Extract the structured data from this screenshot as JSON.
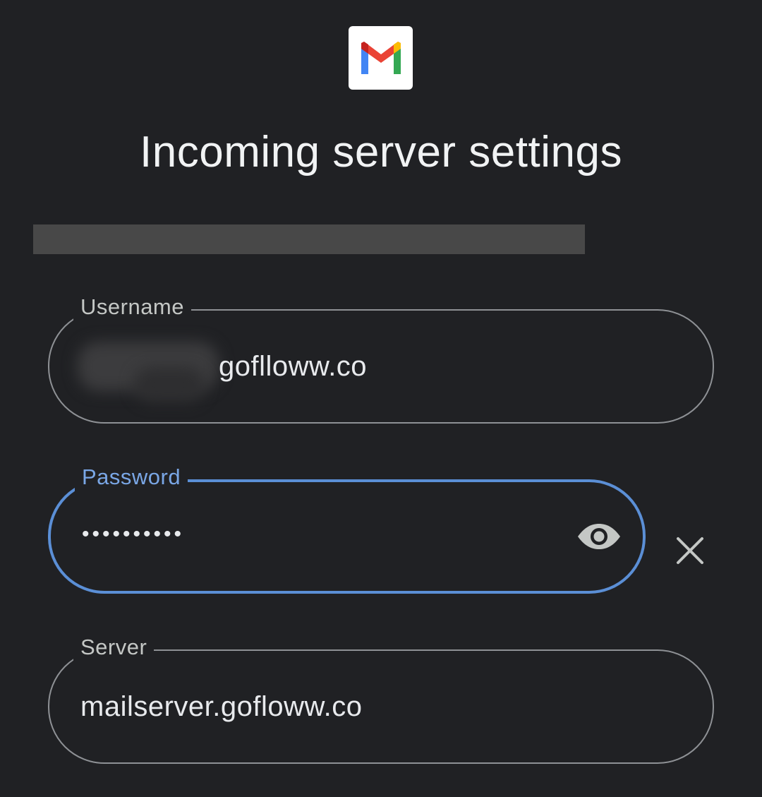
{
  "app": {
    "logo_icon": "gmail-logo-icon",
    "title": "Incoming server settings"
  },
  "form": {
    "username": {
      "label": "Username",
      "value_visible": "goflloww.co"
    },
    "password": {
      "label": "Password",
      "masked_value": "••••••••••",
      "toggle_icon": "eye-icon",
      "state": "focused"
    },
    "clear_icon": "close-icon",
    "server": {
      "label": "Server",
      "value": "mailserver.gofloww.co"
    }
  },
  "colors": {
    "background": "#202124",
    "outline": "#8e9195",
    "focus_accent": "#5b8fd6",
    "label_focused": "#7aa7e6",
    "redacted_bar": "#484848"
  }
}
